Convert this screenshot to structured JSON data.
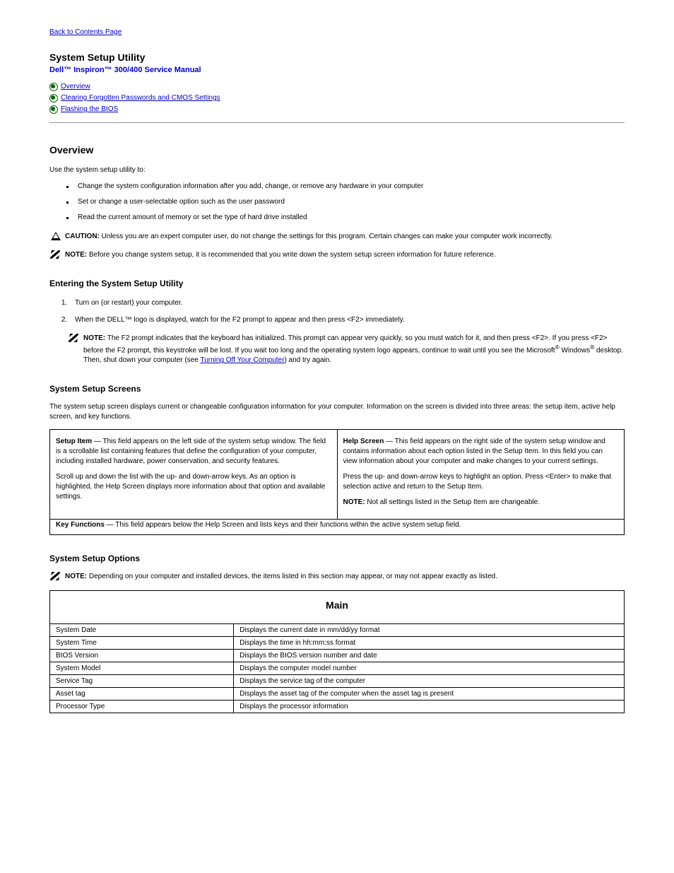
{
  "back_link": {
    "label": "Back to Contents Page"
  },
  "page_title": "System Setup Utility",
  "manual_title": "Dell™ Inspiron™ 300/400 Service Manual",
  "toc": {
    "overview": "Overview",
    "clearing": "Clearing Forgotten Passwords and CMOS Settings",
    "flashing": "Flashing the BIOS"
  },
  "overview": {
    "heading": "Overview",
    "intro": "Use the system setup utility to:",
    "uses": [
      "Change the system configuration information after you add, change, or remove any hardware in your computer",
      "Set or change a user-selectable option such as the user password",
      "Read the current amount of memory or set the type of hard drive installed"
    ],
    "caution_label": "CAUTION:",
    "caution_text": "Unless you are an expert computer user, do not change the settings for this program. Certain changes can make your computer work incorrectly.",
    "note1_label": "NOTE:",
    "note1_text": "Before you change system setup, it is recommended that you write down the system setup screen information for future reference."
  },
  "entering": {
    "heading": "Entering the System Setup Utility",
    "step1": "Turn on (or restart) your computer.",
    "step2_part1": "When the DELL™ logo is displayed, watch for the F2 prompt to appear and then press ",
    "step2_key": "<F2>",
    "step2_part2": " immediately.",
    "note_label": "NOTE:",
    "note_text_1": "The F2 prompt indicates that the keyboard has initialized. This prompt can appear very quickly, so you must watch for it, and then press <F2>. If you press <F2> before the F2 prompt, this keystroke will be lost. If you wait too long and the operating system logo appears, continue to wait until you see the Microsoft",
    "note_reg1": "®",
    "note_text_2": " Windows",
    "note_reg2": "®",
    "note_text_3": " desktop. Then, shut down your computer (see ",
    "note_link": "Turning Off Your Computer",
    "note_text_4": ") and try again."
  },
  "screens": {
    "heading": "System Setup Screens",
    "intro": "The system setup screen displays current or changeable configuration information for your computer. Information on the screen is divided into three areas: the setup item, active help screen, and key functions.",
    "left": {
      "title": "Setup Item",
      "dash": "—",
      "desc": " This field appears on the left side of the system setup window. The field is a scrollable list containing features that define the configuration of your computer, including installed hardware, power conservation, and security features.",
      "p2": "Scroll up and down the list with the up- and down-arrow keys. As an option is highlighted, the Help Screen displays more information about that option and available settings."
    },
    "right": {
      "title": "Help Screen",
      "dash": "—",
      "desc": " This field appears on the right side of the system setup window and contains information about each option listed in the Setup Item. In this field you can view information about your computer and make changes to your current settings.",
      "p2": "Press the up- and down-arrow keys to highlight an option. Press <Enter> to make that selection active and return to the Setup Item.",
      "p3_label": "NOTE:",
      "p3_text": " Not all settings listed in the Setup Item are changeable."
    },
    "bottom": {
      "title": "Key Functions",
      "dash": "—",
      "desc": " This field appears below the Help Screen and lists keys and their functions within the active system setup field."
    }
  },
  "options": {
    "heading": "System Setup Options",
    "note_label": "NOTE:",
    "note_text": "Depending on your computer and installed devices, the items listed in this section may appear, or may not appear exactly as listed.",
    "table_header": "Main",
    "rows": [
      {
        "k": "System Date",
        "v": "Displays the current date in mm/dd/yy format"
      },
      {
        "k": "System Time",
        "v": "Displays the time in hh:mm:ss format"
      },
      {
        "k": "BIOS Version",
        "v": "Displays the BIOS version number and date"
      },
      {
        "k": "System Model",
        "v": "Displays the computer model number"
      },
      {
        "k": "Service Tag",
        "v": "Displays the service tag of the computer"
      },
      {
        "k": "Asset tag",
        "v": "Displays the asset tag of the computer when the asset tag is present"
      },
      {
        "k": "Processor Type",
        "v": "Displays the processor information"
      }
    ]
  }
}
